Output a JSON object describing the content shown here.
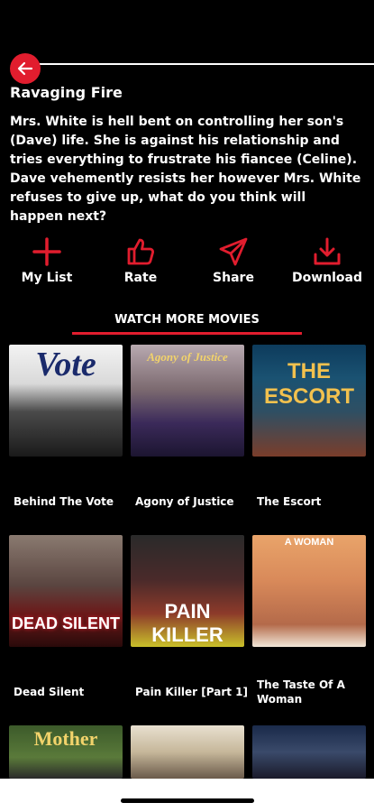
{
  "movie": {
    "title": "Ravaging Fire",
    "synopsis": "Mrs. White is hell bent on controlling her son's (Dave) life. She is against his relationship and tries everything to frustrate his fiancee (Celine). Dave vehemently resists her however Mrs. White refuses to give up, what do you think will happen next?"
  },
  "actions": [
    {
      "label": "My List",
      "icon": "plus-icon"
    },
    {
      "label": "Rate",
      "icon": "thumbs-up-icon"
    },
    {
      "label": "Share",
      "icon": "send-icon"
    },
    {
      "label": "Download",
      "icon": "download-icon"
    }
  ],
  "section": {
    "title": "WATCH MORE MOVIES"
  },
  "movies": [
    {
      "caption": "Behind The Vote",
      "poster_text": "Vote"
    },
    {
      "caption": "Agony of Justice",
      "poster_text": "Agony of Justice"
    },
    {
      "caption": "The Escort",
      "poster_text": "THE ESCORT"
    },
    {
      "caption": "Dead Silent",
      "poster_text": "DEAD SILENT"
    },
    {
      "caption": "Pain Killer [Part 1]",
      "poster_text": "PAIN KILLER"
    },
    {
      "caption": "The Taste Of A Woman",
      "poster_text": "A WOMAN"
    },
    {
      "caption": "",
      "poster_text": "Mother"
    },
    {
      "caption": "",
      "poster_text": ""
    },
    {
      "caption": "",
      "poster_text": ""
    }
  ],
  "colors": {
    "accent": "#e11d2e",
    "background": "#000000"
  }
}
